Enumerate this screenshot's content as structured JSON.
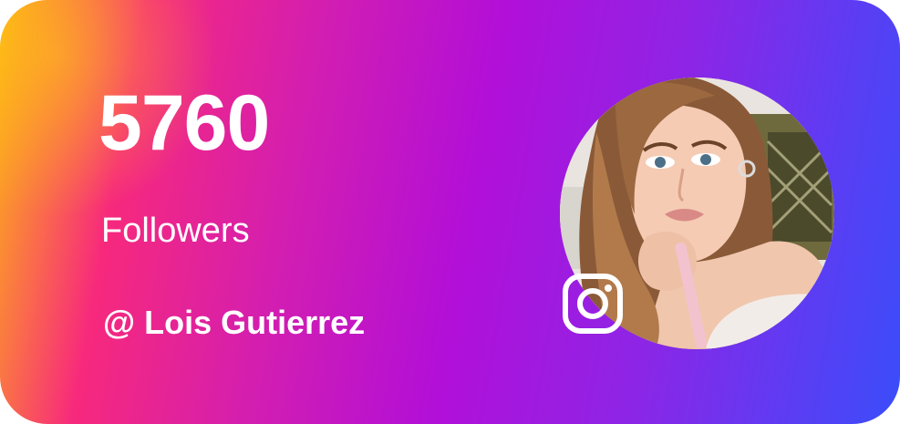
{
  "profile": {
    "followers_count": "5760",
    "followers_label": "Followers",
    "handle": "@ Lois Gutierrez"
  },
  "avatar": {
    "icon": "profile-photo"
  },
  "brand": {
    "icon": "instagram-icon",
    "gradient_colors": [
      "#fdb813",
      "#f7297c",
      "#b20fd8",
      "#3a4df9"
    ]
  }
}
